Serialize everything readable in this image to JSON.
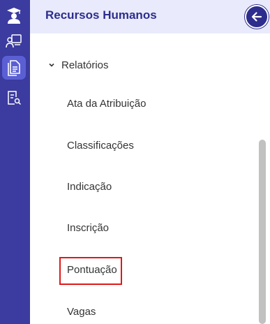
{
  "sidebar": {
    "icons": [
      "graduation-cap-icon",
      "person-board-icon",
      "documents-icon",
      "report-search-icon"
    ],
    "active_index": 2
  },
  "panel": {
    "title": "Recursos Humanos",
    "back_icon": "arrow-left-circle-icon"
  },
  "section": {
    "label": "Relatórios",
    "expanded": true,
    "items": [
      {
        "label": "Ata da Atribuição"
      },
      {
        "label": "Classificações"
      },
      {
        "label": "Indicação"
      },
      {
        "label": "Inscrição"
      },
      {
        "label": "Pontuação",
        "highlighted": true
      },
      {
        "label": "Vagas"
      }
    ]
  },
  "colors": {
    "rail": "#3b3ba0",
    "rail_active": "#5b5fd4",
    "header_bg": "#e9ebfc",
    "title": "#2d2d8e",
    "highlight_border": "#e01818"
  }
}
